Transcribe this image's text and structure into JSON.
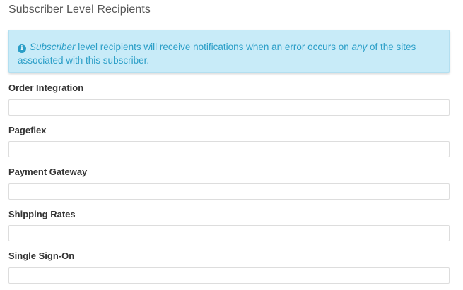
{
  "section": {
    "title": "Subscriber Level Recipients"
  },
  "info": {
    "icon": "info-icon",
    "text_part1": "Subscriber",
    "text_part2": " level recipients will receive notifications when an error occurs on ",
    "text_part3": "any",
    "text_part4": " of the sites associated with this subscriber.",
    "colors": {
      "background": "#c8ebf8",
      "text": "#2a9ec7"
    }
  },
  "fields": [
    {
      "label": "Order Integration",
      "value": ""
    },
    {
      "label": "Pageflex",
      "value": ""
    },
    {
      "label": "Payment Gateway",
      "value": ""
    },
    {
      "label": "Shipping Rates",
      "value": ""
    },
    {
      "label": "Single Sign-On",
      "value": ""
    }
  ]
}
